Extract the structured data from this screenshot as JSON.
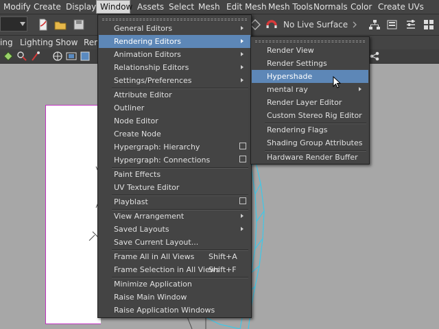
{
  "menubar": {
    "items": [
      "Modify",
      "Create",
      "Display",
      "Window",
      "Assets",
      "Select",
      "Mesh",
      "Edit Mesh",
      "Mesh Tools",
      "Normals",
      "Color",
      "Create UVs"
    ],
    "active": "Window"
  },
  "statusline": {
    "live_surface": "No Live Surface"
  },
  "panel_menu": {
    "items": [
      "ing",
      "Lighting",
      "Show",
      "Ren"
    ]
  },
  "window_menu": {
    "items": [
      {
        "label": "General Editors",
        "submenu": true
      },
      {
        "label": "Rendering Editors",
        "submenu": true,
        "highlighted": true
      },
      {
        "label": "Animation Editors",
        "submenu": true
      },
      {
        "label": "Relationship Editors",
        "submenu": true
      },
      {
        "label": "Settings/Preferences",
        "submenu": true
      },
      {
        "label": "Attribute Editor"
      },
      {
        "label": "Outliner"
      },
      {
        "label": "Node Editor"
      },
      {
        "label": "Create Node"
      },
      {
        "label": "Hypergraph: Hierarchy",
        "option_box": true
      },
      {
        "label": "Hypergraph: Connections",
        "option_box": true
      },
      {
        "label": "Paint Effects"
      },
      {
        "label": "UV Texture Editor"
      },
      {
        "label": "Playblast",
        "option_box": true
      },
      {
        "label": "View Arrangement",
        "submenu": true
      },
      {
        "label": "Saved Layouts",
        "submenu": true
      },
      {
        "label": "Save Current Layout..."
      },
      {
        "label": "Frame All in All Views",
        "shortcut": "Shift+A"
      },
      {
        "label": "Frame Selection in All Views",
        "shortcut": "Shift+F"
      },
      {
        "label": "Minimize Application"
      },
      {
        "label": "Raise Main Window"
      },
      {
        "label": "Raise Application Windows"
      }
    ]
  },
  "rendering_submenu": {
    "items": [
      {
        "label": "Render View"
      },
      {
        "label": "Render Settings"
      },
      {
        "label": "Hypershade",
        "highlighted": true
      },
      {
        "label": "mental ray",
        "submenu": true
      },
      {
        "label": "Render Layer Editor"
      },
      {
        "label": "Custom Stereo Rig Editor"
      },
      {
        "label": "Rendering Flags"
      },
      {
        "label": "Shading Group Attributes"
      },
      {
        "label": "Hardware Render Buffer"
      }
    ]
  },
  "colors": {
    "highlight": "#5d87b7",
    "menu_bg": "#444444",
    "viewport_bg": "#a7a7a7",
    "wireframe": "#3fc8e8",
    "selection_outline": "#c030c0"
  }
}
